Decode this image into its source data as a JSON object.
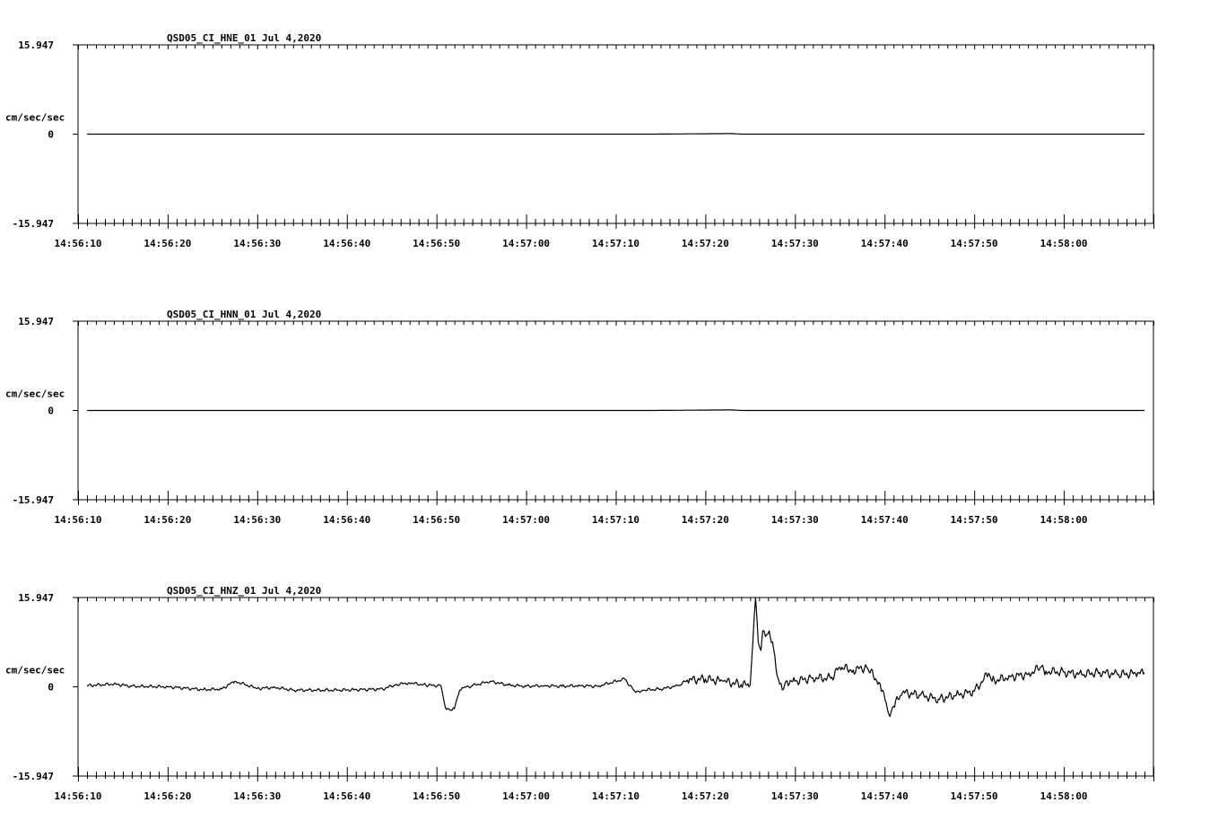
{
  "chart_data": [
    {
      "type": "line",
      "title": "QSD05_CI_HNE_01  Jul 4,2020",
      "ylabel": "cm/sec/sec",
      "ylim": [
        -15.947,
        15.947
      ],
      "ytick_labels": [
        "15.947",
        "0",
        "-15.947"
      ],
      "xtick_labels": [
        "14:56:10",
        "14:56:20",
        "14:56:30",
        "14:56:40",
        "14:56:50",
        "14:57:00",
        "14:57:10",
        "14:57:20",
        "14:57:30",
        "14:57:40",
        "14:57:50",
        "14:58:00"
      ],
      "series": [
        {
          "x": [
            7,
            20,
            30,
            40,
            50,
            60,
            70,
            79,
            80,
            90,
            100,
            110,
            125
          ],
          "y": [
            0,
            0,
            0,
            0,
            0,
            0,
            0,
            0.1,
            0,
            0,
            0,
            0,
            0
          ]
        }
      ]
    },
    {
      "type": "line",
      "title": "QSD05_CI_HNN_01  Jul 4,2020",
      "ylabel": "cm/sec/sec",
      "ylim": [
        -15.947,
        15.947
      ],
      "ytick_labels": [
        "15.947",
        "0",
        "-15.947"
      ],
      "xtick_labels": [
        "14:56:10",
        "14:56:20",
        "14:56:30",
        "14:56:40",
        "14:56:50",
        "14:57:00",
        "14:57:10",
        "14:57:20",
        "14:57:30",
        "14:57:40",
        "14:57:50",
        "14:58:00"
      ],
      "series": [
        {
          "x": [
            7,
            20,
            30,
            40,
            50,
            60,
            70,
            79,
            80,
            90,
            100,
            110,
            125
          ],
          "y": [
            0,
            0,
            0,
            0,
            0,
            0,
            0,
            0.1,
            0,
            0,
            0,
            0,
            0
          ]
        }
      ]
    },
    {
      "type": "line",
      "title": "QSD05_CI_HNZ_01  Jul 4,2020",
      "ylabel": "cm/sec/sec",
      "ylim": [
        -15.947,
        15.947
      ],
      "ytick_labels": [
        "15.947",
        "0",
        "-15.947"
      ],
      "xtick_labels": [
        "14:56:10",
        "14:56:20",
        "14:56:30",
        "14:56:40",
        "14:56:50",
        "14:57:00",
        "14:57:10",
        "14:57:20",
        "14:57:30",
        "14:57:40",
        "14:57:50",
        "14:58:00"
      ],
      "series": [
        {
          "x": [
            7,
            10,
            12,
            16,
            20,
            22,
            23.5,
            26,
            28,
            30,
            35,
            40,
            41.5,
            43,
            44.8,
            46.5,
            47,
            47.5,
            48,
            48.6,
            49,
            50,
            52,
            54,
            56,
            58,
            60,
            62,
            64,
            67,
            68.2,
            68.4,
            69,
            71,
            73,
            74,
            76,
            78,
            80,
            81,
            81.6,
            81.9,
            82.2,
            82.4,
            82.7,
            83,
            83.5,
            84,
            84.3,
            84.6,
            85,
            86,
            88,
            90,
            91,
            92.5,
            94,
            95.5,
            96.2,
            96.6,
            97,
            98,
            100,
            102,
            104,
            106,
            107.6,
            108,
            110,
            112,
            113.5,
            114,
            116,
            118,
            120,
            122,
            124,
            125
          ],
          "y": [
            0.2,
            0.5,
            0.1,
            0,
            -0.5,
            -0.4,
            1.0,
            -0.3,
            -0.1,
            -0.6,
            -0.6,
            -0.4,
            0.4,
            0.7,
            0.3,
            0.2,
            -3.8,
            -4.2,
            -3.9,
            -0.6,
            -0.2,
            0.2,
            1.0,
            0.3,
            0.1,
            0.2,
            0.1,
            0.2,
            0.1,
            1.4,
            -1.0,
            -0.8,
            -0.6,
            -0.4,
            0.2,
            1.2,
            1.4,
            1.0,
            0.4,
            0.3,
            15.9,
            8.0,
            6.5,
            10.0,
            9.0,
            9.5,
            8.0,
            2.0,
            0.5,
            -0.6,
            1.0,
            1.0,
            1.6,
            1.5,
            3.5,
            3.0,
            3.5,
            0.5,
            -3.0,
            -5.3,
            -3.5,
            -1.0,
            -1.5,
            -2.2,
            -1.5,
            -0.8,
            2.4,
            1.0,
            1.8,
            2.2,
            3.6,
            2.8,
            2.6,
            2.2,
            2.6,
            2.2,
            2.4,
            2.5
          ]
        }
      ]
    }
  ]
}
